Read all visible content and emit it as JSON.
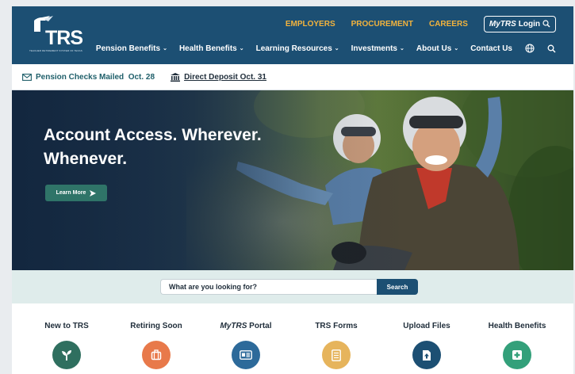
{
  "header": {
    "logo_text": "TRS",
    "logo_subtitle": "TEACHER RETIREMENT SYSTEM OF TEXAS",
    "top_links": [
      "EMPLOYERS",
      "PROCUREMENT",
      "CAREERS"
    ],
    "login": {
      "prefix": "MyTRS",
      "suffix": "Login"
    },
    "nav": [
      {
        "label": "Pension Benefits"
      },
      {
        "label": "Health Benefits"
      },
      {
        "label": "Learning Resources"
      },
      {
        "label": "Investments"
      },
      {
        "label": "About Us"
      },
      {
        "label": "Contact Us"
      }
    ]
  },
  "alerts": {
    "pension": "Pension Checks Mailed  Oct. 28",
    "deposit": "Direct Deposit Oct. 31"
  },
  "hero": {
    "title": "Account Access. Wherever. Whenever.",
    "button": "Learn More"
  },
  "search": {
    "placeholder": "What are you looking for?",
    "button": "Search"
  },
  "quick_links": [
    {
      "label": "New to TRS",
      "color": "#2f6f5f",
      "icon": "sprout-icon"
    },
    {
      "label": "Retiring Soon",
      "color": "#e8794a",
      "icon": "suitcase-icon"
    },
    {
      "label_em": "MyTRS",
      "label_rest": " Portal",
      "color": "#2d6a9a",
      "icon": "id-card-icon"
    },
    {
      "label": "TRS Forms",
      "color": "#e6b45c",
      "icon": "document-icon"
    },
    {
      "label": "Upload Files",
      "color": "#1c4f73",
      "icon": "file-upload-icon"
    },
    {
      "label": "Health Benefits",
      "color": "#33a07a",
      "icon": "medical-plus-icon"
    }
  ],
  "colors": {
    "brand_navy": "#1c4f73",
    "accent_gold": "#f2b33d",
    "teal": "#2f7468"
  }
}
